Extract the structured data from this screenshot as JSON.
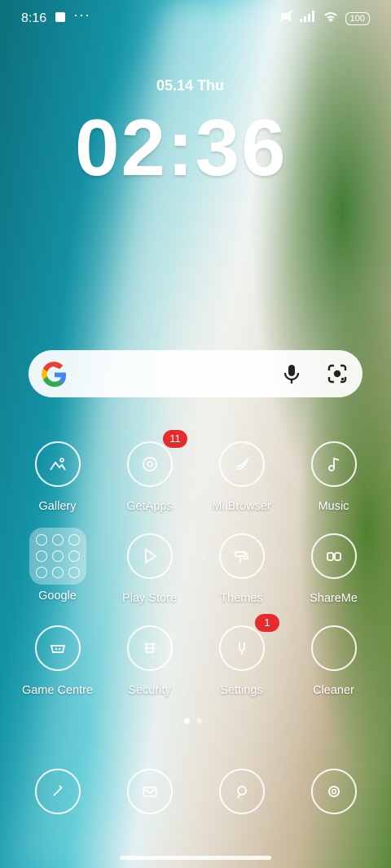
{
  "status_bar": {
    "time": "8:16",
    "more": "···",
    "battery": "100"
  },
  "lock": {
    "date": "05.14",
    "weekday": "Thu",
    "time": "02:36"
  },
  "search": {
    "icons": [
      "google-logo",
      "mic-icon",
      "lens-icon"
    ]
  },
  "apps": [
    {
      "label": "Gallery",
      "badge": ""
    },
    {
      "label": "GetApps",
      "badge": "11"
    },
    {
      "label": "Mi Browser",
      "badge": ""
    },
    {
      "label": "Music",
      "badge": ""
    },
    {
      "label": "Google",
      "badge": ""
    },
    {
      "label": "Play Store",
      "badge": ""
    },
    {
      "label": "Themes",
      "badge": ""
    },
    {
      "label": "ShareMe",
      "badge": ""
    },
    {
      "label": "Game Centre",
      "badge": ""
    },
    {
      "label": "Security",
      "badge": ""
    },
    {
      "label": "Settings",
      "badge": "1"
    },
    {
      "label": "Cleaner",
      "badge": ""
    }
  ],
  "dock": [
    {
      "icon": "phone-icon"
    },
    {
      "icon": "messages-icon"
    },
    {
      "icon": "browser-icon"
    },
    {
      "icon": "camera-icon"
    }
  ],
  "colors": {
    "badge": "#e52b2b"
  }
}
